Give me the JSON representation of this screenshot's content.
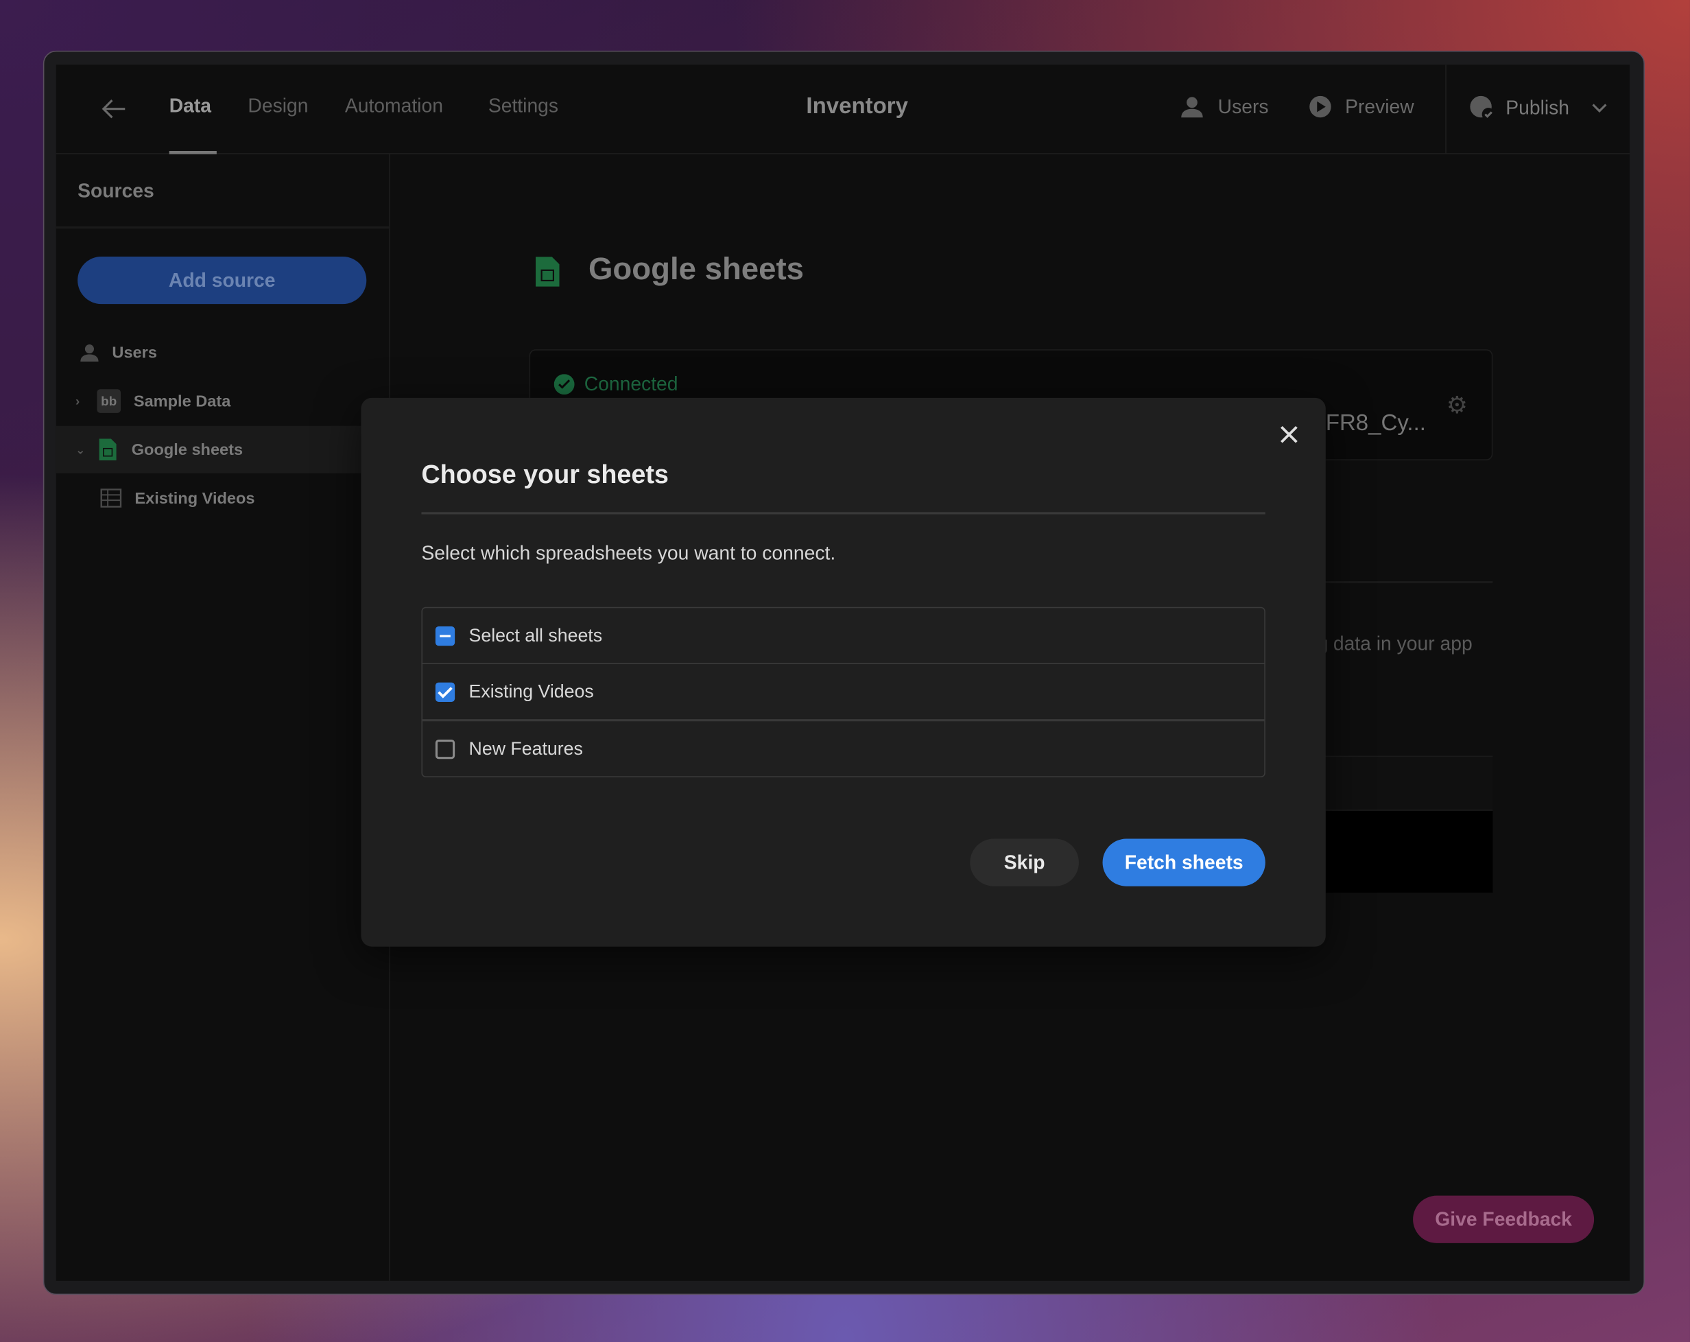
{
  "header": {
    "back_icon": "arrow-left-icon",
    "tabs": [
      {
        "label": "Data",
        "active": true
      },
      {
        "label": "Design"
      },
      {
        "label": "Automation"
      },
      {
        "label": "Settings"
      }
    ],
    "title": "Inventory",
    "users_label": "Users",
    "preview_label": "Preview",
    "publish_label": "Publish"
  },
  "sidebar": {
    "title": "Sources",
    "add_source_label": "Add source",
    "items": [
      {
        "label": "Users",
        "icon": "user-icon"
      },
      {
        "label": "Sample Data",
        "icon": "budibase-icon"
      },
      {
        "label": "Google sheets",
        "icon": "google-sheets-icon",
        "selected": true
      },
      {
        "label": "Existing Videos",
        "icon": "table-icon"
      }
    ]
  },
  "main": {
    "title": "Google sheets",
    "status": "Connected",
    "sheet_id_truncated": "FR8_Cy...",
    "partial_text": "g data in your app"
  },
  "modal": {
    "title": "Choose your sheets",
    "description": "Select which spreadsheets you want to connect.",
    "options": [
      {
        "label": "Select all sheets",
        "state": "indeterminate"
      },
      {
        "label": "Existing Videos",
        "state": "checked"
      },
      {
        "label": "New Features",
        "state": "unchecked"
      }
    ],
    "skip_label": "Skip",
    "fetch_label": "Fetch sheets"
  },
  "feedback_label": "Give Feedback",
  "colors": {
    "accent": "#2f7de1",
    "connected": "#1e7a45",
    "feedback": "#6b1d4a"
  }
}
